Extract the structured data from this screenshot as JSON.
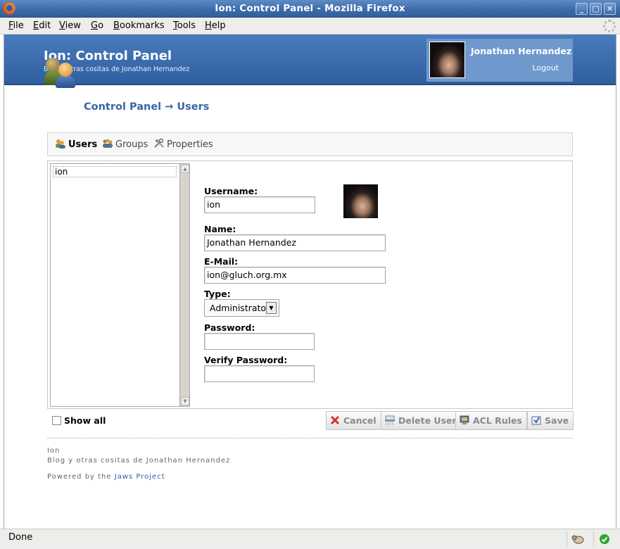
{
  "window": {
    "title": "Ion: Control Panel - Mozilla Firefox",
    "buttons": [
      "_",
      "□",
      "✕"
    ]
  },
  "menubar": {
    "items": [
      {
        "key": "F",
        "rest": "ile"
      },
      {
        "key": "E",
        "rest": "dit"
      },
      {
        "key": "V",
        "rest": "iew"
      },
      {
        "key": "G",
        "rest": "o"
      },
      {
        "key": "B",
        "rest": "ookmarks"
      },
      {
        "key": "T",
        "rest": "ools"
      },
      {
        "key": "H",
        "rest": "elp"
      }
    ]
  },
  "header": {
    "site_title": "Ion: Control Panel",
    "tagline": "Blog y otras cositas de Jonathan Hernandez",
    "user_name": "Jonathan Hernandez",
    "logout": "Logout"
  },
  "breadcrumb": "Control Panel → Users",
  "tabs": [
    {
      "label": "Users",
      "icon": "users-icon",
      "active": true
    },
    {
      "label": "Groups",
      "icon": "groups-icon",
      "active": false
    },
    {
      "label": "Properties",
      "icon": "tools-icon",
      "active": false
    }
  ],
  "user_list": [
    "ion"
  ],
  "form": {
    "username_label": "Username:",
    "username_value": "ion",
    "name_label": "Name:",
    "name_value": "Jonathan Hernandez",
    "email_label": "E-Mail:",
    "email_value": "ion@gluch.org.mx",
    "type_label": "Type:",
    "type_value": "Administrator",
    "password_label": "Password:",
    "password_value": "",
    "verify_label": "Verify Password:",
    "verify_value": ""
  },
  "show_all": "Show all",
  "actions": {
    "cancel": "Cancel",
    "delete": "Delete User",
    "acl": "ACL Rules",
    "save": "Save"
  },
  "footer": {
    "site": "Ion",
    "tagline": "Blog y otras cositas de Jonathan Hernandez",
    "powered_prefix": "Powered by the",
    "powered_link": "Jaws Project"
  },
  "status": {
    "text": "Done"
  },
  "colors": {
    "banner": "#3a6aab",
    "link": "#3a64a8",
    "ok": "#2fa52f"
  }
}
